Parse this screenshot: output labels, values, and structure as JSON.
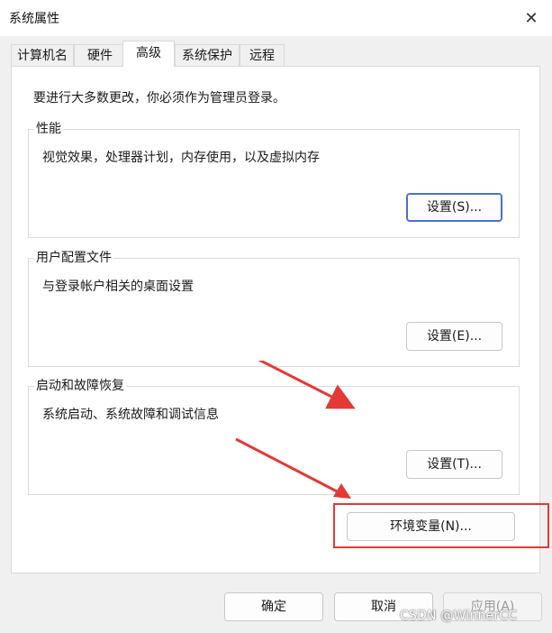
{
  "window": {
    "title": "系统属性",
    "close_glyph": "✕"
  },
  "tabs": [
    {
      "label": "计算机名",
      "active": false
    },
    {
      "label": "硬件",
      "active": false
    },
    {
      "label": "高级",
      "active": true
    },
    {
      "label": "系统保护",
      "active": false
    },
    {
      "label": "远程",
      "active": false
    }
  ],
  "panel": {
    "notice": "要进行大多数更改，你必须作为管理员登录。",
    "groups": [
      {
        "title": "性能",
        "desc": "视觉效果，处理器计划，内存使用，以及虚拟内存",
        "button": "设置(S)..."
      },
      {
        "title": "用户配置文件",
        "desc": "与登录帐户相关的桌面设置",
        "button": "设置(E)..."
      },
      {
        "title": "启动和故障恢复",
        "desc": "系统启动、系统故障和调试信息",
        "button": "设置(T)..."
      }
    ],
    "env_button": "环境变量(N)..."
  },
  "footer": {
    "ok": "确定",
    "cancel": "取消",
    "apply": "应用(A)"
  },
  "watermark": "CSDN @WinnerCC",
  "colors": {
    "annotation_red": "#e53935",
    "focus_blue": "#4a6fd3"
  }
}
